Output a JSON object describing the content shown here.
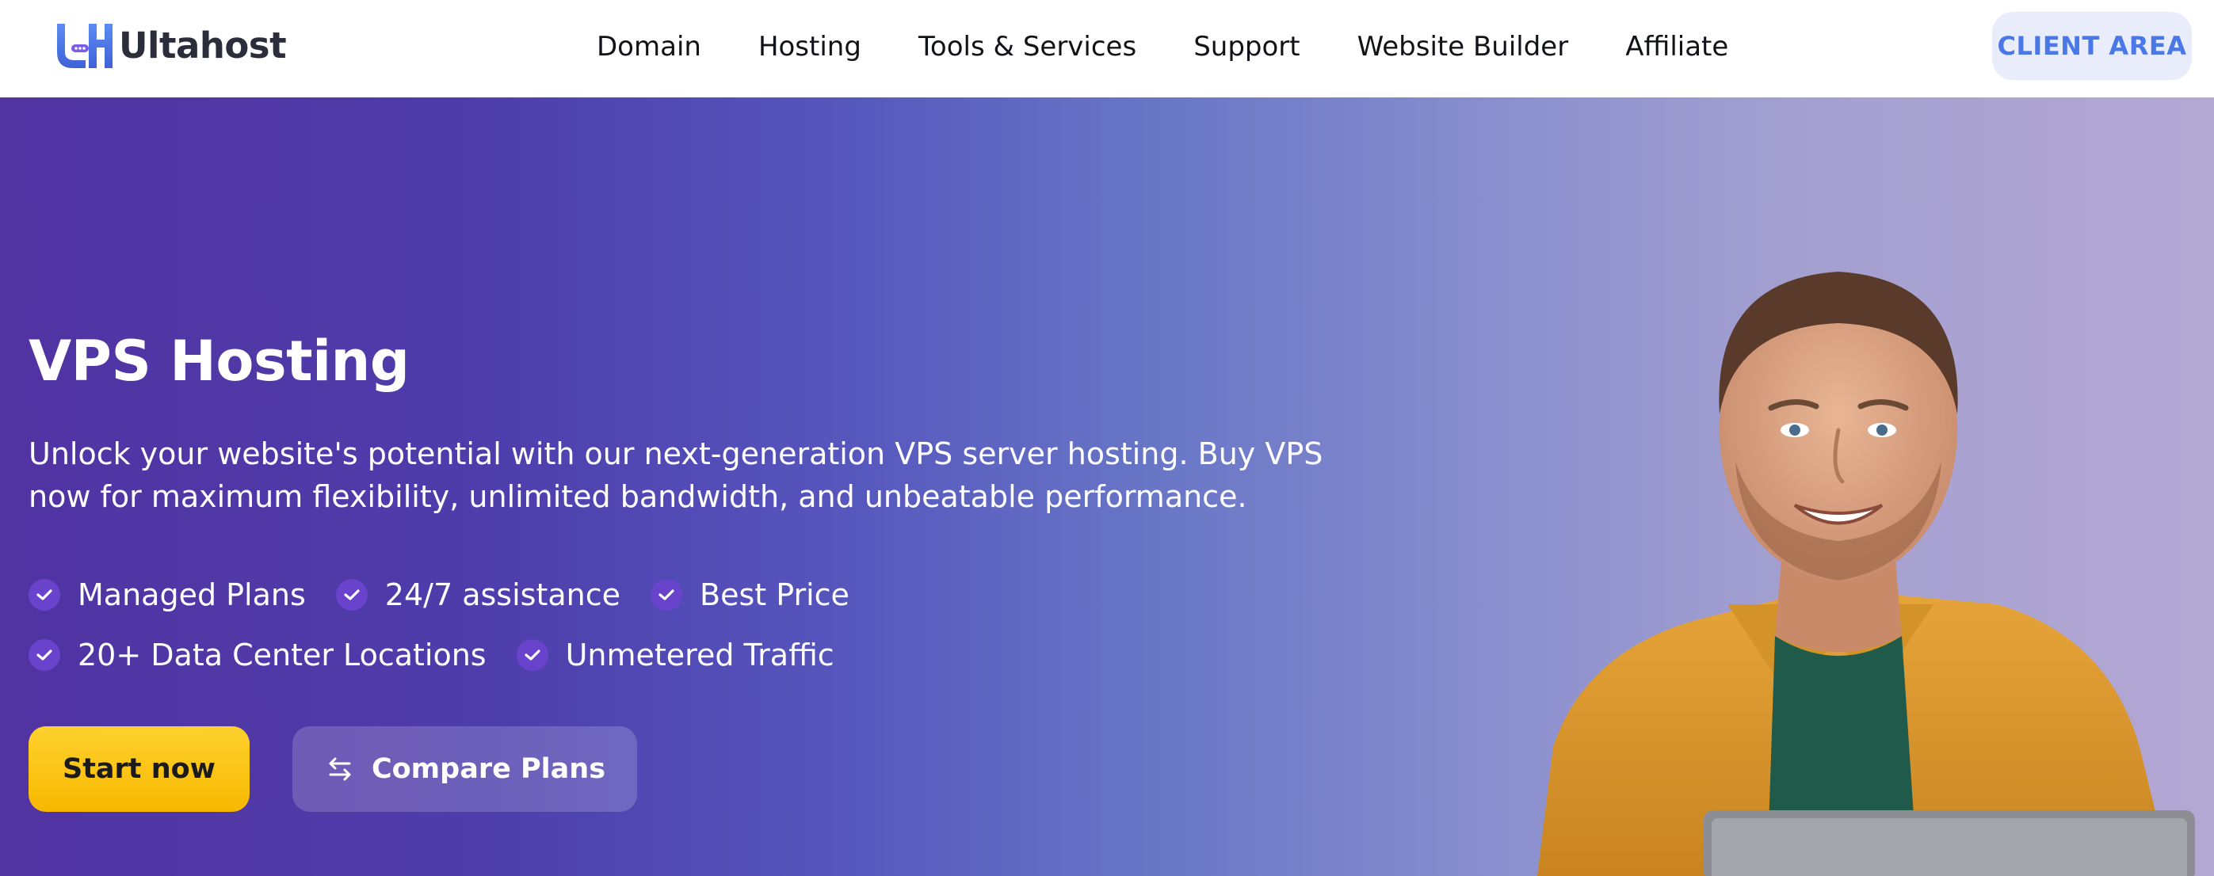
{
  "header": {
    "logo_text": "Ultahost",
    "nav": [
      "Domain",
      "Hosting",
      "Tools & Services",
      "Support",
      "Website Builder",
      "Affiliate"
    ],
    "client_area": "CLIENT AREA"
  },
  "hero": {
    "title": "VPS Hosting",
    "description": "Unlock your website's potential with our next-generation VPS server hosting. Buy VPS now for maximum flexibility, unlimited bandwidth, and unbeatable performance.",
    "features_row1": [
      "Managed Plans",
      "24/7 assistance",
      "Best Price"
    ],
    "features_row2": [
      "20+ Data Center Locations",
      "Unmetered Traffic"
    ],
    "start_button": "Start now",
    "compare_button": "Compare Plans"
  },
  "colors": {
    "brand_blue": "#4a78e6",
    "hero_purple": "#5133a2",
    "cta_yellow": "#ffd12e"
  },
  "icons": [
    "check-icon",
    "compare-arrows-icon",
    "ultahost-logo"
  ]
}
